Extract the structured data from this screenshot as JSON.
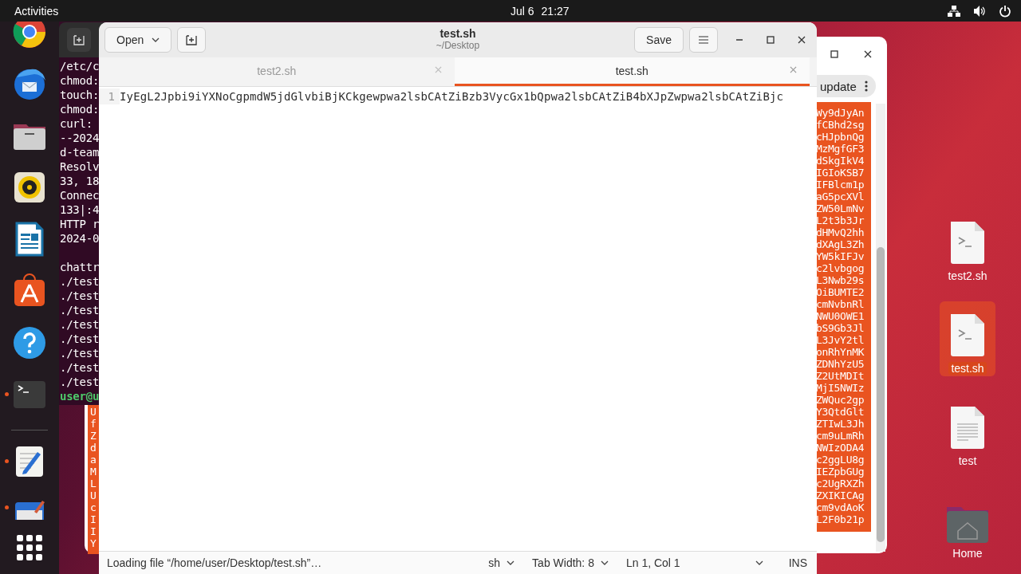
{
  "top_bar": {
    "activities": "Activities",
    "date": "Jul 6",
    "time": "21:27"
  },
  "dock": {
    "items": [
      {
        "kind": "browser",
        "running": false
      },
      {
        "kind": "mail",
        "running": false
      },
      {
        "kind": "files",
        "running": false
      },
      {
        "kind": "music",
        "running": false
      },
      {
        "kind": "writer",
        "running": false
      },
      {
        "kind": "store",
        "running": false
      },
      {
        "kind": "help",
        "running": false
      },
      {
        "kind": "terminal",
        "running": true
      },
      {
        "kind": "separator"
      },
      {
        "kind": "editor",
        "running": true
      },
      {
        "kind": "partial",
        "running": true
      },
      {
        "kind": "apps",
        "running": false
      }
    ]
  },
  "terminal": {
    "blocks": [
      [
        "/etc/c",
        "chmod:",
        "touch:",
        "chmod:",
        "curl:",
        "--2024",
        "d-team",
        "Resolv",
        "33, 18",
        "Connec",
        "133|:4",
        "HTTP r",
        "2024-0"
      ],
      [
        "chattr",
        "./test",
        "./test",
        "./test",
        "./test",
        "./test",
        "./test",
        "./test",
        "./test"
      ]
    ],
    "prompt": "user@u"
  },
  "background_window": {
    "button": "update",
    "left_column": [
      "U",
      "f",
      "Z",
      "d",
      "a",
      "M",
      "L",
      "U",
      "c",
      "I",
      "I",
      "Y"
    ],
    "right_column": [
      "Wy9dJyAn",
      "fCBhd2sg",
      "cHJpbnQg",
      "MzMgfGF3",
      "dSkgIkV4",
      "IGIoKSB7",
      "IFBlcm1p",
      "aG5pcXVl",
      "ZW50LmNv",
      "L2t3b3Jr",
      "dHMvQ2hh",
      "dXAgL3Zh",
      "YW5kIFJv",
      "c2lvbgog",
      "L3Nwb29s",
      "OiBUMTE2",
      "cmNvbnRl",
      "NWU0OWE1",
      "bS9Gb3Jl",
      "L3JvY2tl",
      "onRhYnMK",
      "ZDNhYzU5",
      "Z2UtMDIt",
      "MjI5NWIz",
      "ZWQuc2gp",
      "Y3QtdGlt",
      "ZTIwL3Jh",
      "cm9uLmRh",
      "NWIzODA4",
      "c2ggLU8g",
      "IEZpbGUg",
      "c2UgRXZh",
      "ZXIKICAg",
      "cm9vdAoK",
      "L2F0b21p"
    ]
  },
  "editor": {
    "title": "test.sh",
    "subtitle": "~/Desktop",
    "open_button": "Open",
    "save_button": "Save",
    "tabs": [
      {
        "label": "test2.sh",
        "selected": false
      },
      {
        "label": "test.sh",
        "selected": true
      }
    ],
    "lines": [
      {
        "number": "1",
        "text": "IyEgL2Jpbi9iYXNoCgpmdW5jdGlvbiBjKCkgewpwa2lsbCAtZiBzb3VycGx1bQpwa2lsbCAtZiB4bXJpZwpwa2lsbCAtZiBjc"
      }
    ],
    "status_bar": {
      "message": "Loading file “/home/user/Desktop/test.sh”…",
      "language": "sh",
      "tab_width": "Tab Width: 8",
      "position": "Ln 1, Col 1",
      "mode": "INS"
    }
  },
  "desktop_icons": [
    {
      "label": "test2.sh",
      "kind": "script",
      "selected": false
    },
    {
      "label": "test.sh",
      "kind": "script",
      "selected": true
    },
    {
      "label": "test",
      "kind": "text",
      "selected": false
    },
    {
      "label": "Home",
      "kind": "folder",
      "selected": false
    }
  ]
}
